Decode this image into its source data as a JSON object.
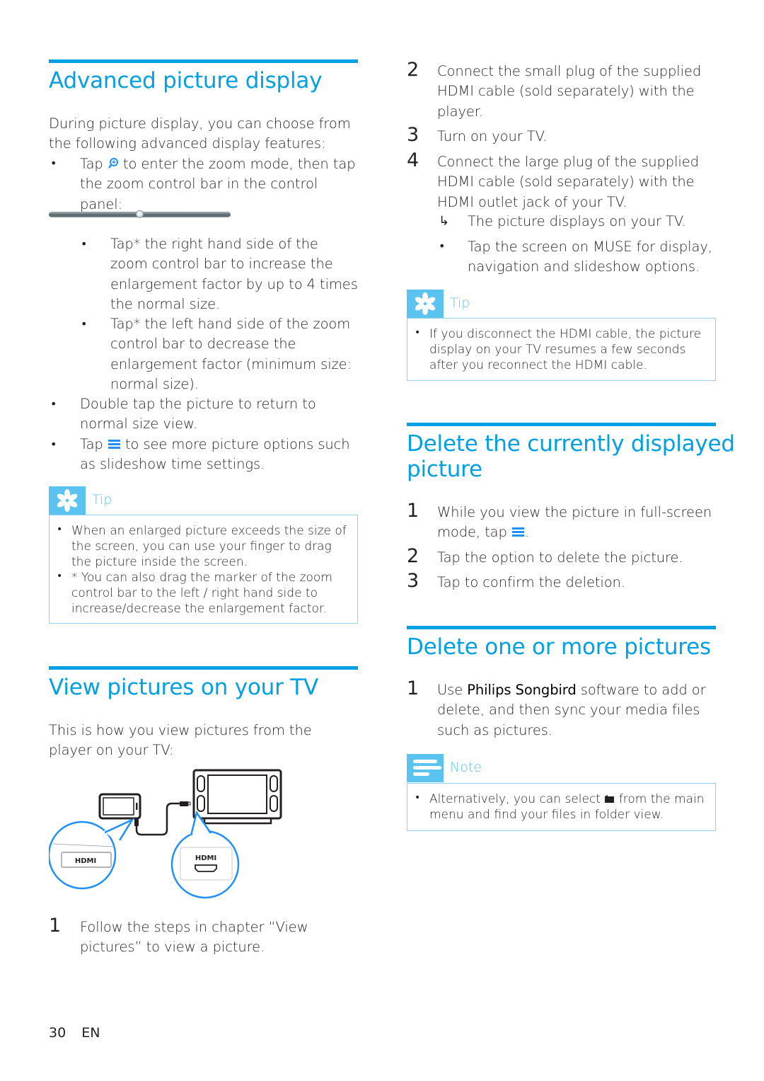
{
  "left": {
    "advanced": {
      "title": "Advanced picture display",
      "intro": "During picture display, you can choose from the following advanced display features:",
      "bullet1_a": "Tap",
      "bullet1_b": "to enter the zoom mode, then tap the zoom control bar in the control panel:",
      "zoom_bar_position": 0.5,
      "sub_bullets": [
        "Tap* the right hand side of the zoom control bar to increase the enlargement factor by up to 4 times the normal size.",
        "Tap* the left hand side of the zoom control bar to decrease the enlargement factor (minimum size: normal size)."
      ],
      "bullet2": "Double tap the picture to return to normal size view.",
      "bullet3_a": "Tap",
      "bullet3_b": "to see more picture options such as slideshow time settings.",
      "tip": {
        "label": "Tip",
        "items": [
          "When an enlarged picture exceeds the size of the screen, you can use your finger to drag the picture inside the screen.",
          "* You can also drag the marker of the zoom control bar to the left / right hand side to increase/decrease the enlargement factor."
        ]
      }
    },
    "view_tv": {
      "title": "View pictures on your TV",
      "intro": "This is how you view pictures from the player on your TV:",
      "hdmi_label_left": "HDMI",
      "hdmi_label_right": "HDMI",
      "step1_num": "1",
      "step1": "Follow the steps in chapter “View pictures” to view a picture."
    }
  },
  "right": {
    "steps": [
      {
        "num": "2",
        "text": "Connect the small plug of the supplied HDMI cable (sold separately) with the player."
      },
      {
        "num": "3",
        "text": "Turn on your TV."
      },
      {
        "num": "4",
        "text": "Connect the large plug of the supplied HDMI cable (sold separately) with the HDMI outlet jack of your TV."
      }
    ],
    "result_arrow": "↳",
    "result_text": "The picture displays on your TV.",
    "result_bullet": "Tap the screen on MUSE for display, navigation and slideshow options.",
    "tip": {
      "label": "Tip",
      "items": [
        "If you disconnect the HDMI cable, the picture display on your TV resumes a few seconds after you reconnect the HDMI cable."
      ]
    },
    "delete_current": {
      "title_line1": "Delete the currently displayed",
      "title_line2": "picture",
      "steps": [
        {
          "num": "1",
          "text_a": "While you view the picture in full-screen mode, tap",
          "text_b": "."
        },
        {
          "num": "2",
          "text": "Tap the option to delete the picture."
        },
        {
          "num": "3",
          "text": "Tap to confirm the deletion."
        }
      ]
    },
    "delete_more": {
      "title": "Delete one or more pictures",
      "step_num": "1",
      "step_a": "Use",
      "step_bold": "Philips Songbird",
      "step_b": "software to add or delete, and then sync your media files such as pictures.",
      "note": {
        "label": "Note",
        "text_a": "Alternatively, you can select",
        "text_b": "from the main menu and find your files in folder view."
      }
    }
  },
  "footer": {
    "page": "30",
    "lang": "EN"
  }
}
